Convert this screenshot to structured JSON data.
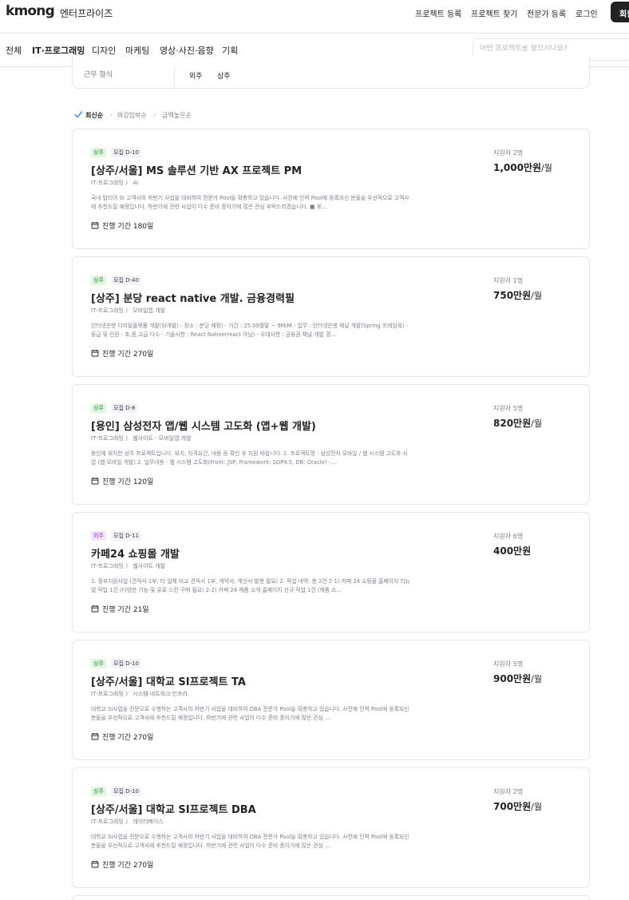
{
  "header": {
    "logo": "kmong",
    "logo_sub": "엔터프라이즈",
    "nav": [
      "프로젝트 등록",
      "프로젝트 찾기",
      "전문가 등록",
      "로그인"
    ],
    "signup": "회원가입"
  },
  "categories": [
    "전체",
    "IT·프로그래밍",
    "디자인",
    "마케팅",
    "영상·사진·음향",
    "기획"
  ],
  "active_category": "IT·프로그래밍",
  "search": {
    "placeholder": "어떤 프로젝트를 찾으시나요?"
  },
  "filter": {
    "label": "근무 형식",
    "options": [
      "외주",
      "상주"
    ]
  },
  "sort": {
    "options": [
      "최신순",
      "마감임박순",
      "금액높은순"
    ],
    "active": "최신순"
  },
  "projects": [
    {
      "type": "상주",
      "deadline": "모집 D-10",
      "title": "[상주/서울] MS 솔루션 기반 AX 프로젝트 PM",
      "path": "IT·프로그래밍 〉 AI",
      "desc": "국내 탑티어 SI 고객사의 하반기 사업을 대비하여 전문가 Pool을 확충하고 있습니다. 사전에 인력 Pool에 등록되신 분들을 우선적으로 고객사에 추천드릴 예정입니다. 하반기에 관련 사업이 다수 준비 중이기에 많은 관심 부탁드리겠습니다. ■ 포...",
      "period": "진행 기간 180일",
      "applicants": "지원자 2명",
      "price": "1,000만원",
      "unit": "/월"
    },
    {
      "type": "상주",
      "deadline": "모집 D-40",
      "title": "[상주] 분당 react native 개발. 금융경력필",
      "path": "IT·프로그래밍 〉 모바일앱 개발",
      "desc": "인터넷은행 디지털플랫폼 개발(SI개발) - 장소 : 분당 예정) - 기간 : 25.09월말 ~ 9M/M - 업무 : 인터넷은행 채널 개발(Spring 프레임웍) - 등급 및 인원 : 초,중,고급 다수 - 기술사항 : React Native(react 아님) - 우대사항 : 금융권 채널 개발 경...",
      "period": "진행 기간 270일",
      "applicants": "지원자 1명",
      "price": "750만원",
      "unit": "/월"
    },
    {
      "type": "상주",
      "deadline": "모집 D-8",
      "title": "[용인] 삼성전자 앱/웹 시스템 고도화 (앱+웹 개발)",
      "path": "IT·프로그래밍 〉 웹사이트 · 모바일앱 개발",
      "desc": "용인에 위치한 상주 프로젝트입니다. 위치, 자격요건, 내용 등 확인 후 지원 바랍니다. 1. 프로젝트명 - 삼성전자 모바일 / 웹 시스템 고도화 사업 (웹-모바일 개발) 2. 업무내용 - 웹 시스템 고도화(Front: JSP, Framework: SDP4.5, DB: Oracle) -...",
      "period": "진행 기간 120일",
      "applicants": "지원자 5명",
      "price": "820만원",
      "unit": "/월"
    },
    {
      "type": "외주",
      "deadline": "모집 D-11",
      "title": "카페24 쇼핑몰 개발",
      "path": "IT·프로그래밍 〉 웹사이트 개발",
      "desc": "1. 정부지원사업 (견적서 1부, 타 업체 비교 견적서 1부, 계약서, 계산서 발행 필요) 2. 작업 내역: 총 2건 2-1) 카페 24 쇼핑몰 홈페이지 리뉴얼 작업 1건 (다양한 기능 및 유료 스킨 구매 필요) 2-2) 카페 24 제품 소개 홈페이지 신규 작업 1건 (제품 소...",
      "period": "진행 기간 21일",
      "applicants": "지원자 6명",
      "price": "400만원",
      "unit": ""
    },
    {
      "type": "상주",
      "deadline": "모집 D-10",
      "title": "[상주/서울] 대학교 SI프로젝트 TA",
      "path": "IT·프로그래밍 〉 시스템·네트워크·인프라",
      "desc": "대학교 SI사업을 전문으로 수행하는 고객사의 하반기 사업을 대비하여 DBA 전문가 Pool을 확충하고 있습니다. 사전에 인력 Pool에 등록되신 분들을 우선적으로 고객사에 추천드릴 예정입니다. 하반기에 관련 사업이 다수 준비 중이기에 많은 관심 ...",
      "period": "진행 기간 270일",
      "applicants": "지원자 5명",
      "price": "900만원",
      "unit": "/월"
    },
    {
      "type": "상주",
      "deadline": "모집 D-10",
      "title": "[상주/서울] 대학교 SI프로젝트 DBA",
      "path": "IT·프로그래밍 〉 데이터베이스",
      "desc": "대학교 SI사업을 전문으로 수행하는 고객사의 하반기 사업을 대비하여 DBA 전문가 Pool을 확충하고 있습니다. 사전에 인력 Pool에 등록되신 분들을 우선적으로 고객사에 추천드릴 예정입니다. 하반기에 관련 사업이 다수 준비 중이기에 많은 관심 ...",
      "period": "진행 기간 270일",
      "applicants": "지원자 2명",
      "price": "700만원",
      "unit": "/월"
    }
  ],
  "colors": {
    "text": "#212224",
    "muted": "#7d7e8a",
    "border": "#e4e5ed",
    "badge_onsite_bg": "#e3f6de",
    "badge_onsite_text": "#1e8a2f",
    "badge_outsource_bg": "#f1e6fb",
    "badge_outsource_text": "#8a3fc4",
    "accent": "#3b82f6"
  }
}
